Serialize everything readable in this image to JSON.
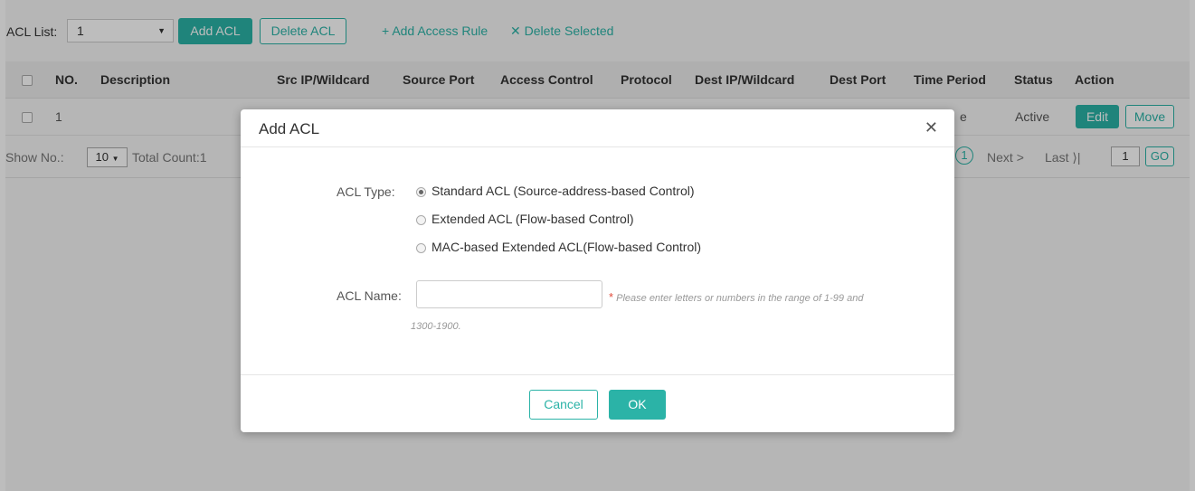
{
  "toolbar": {
    "acl_list_label": "ACL List:",
    "acl_list_value": "1",
    "add_acl_label": "Add ACL",
    "delete_acl_label": "Delete ACL",
    "add_access_rule_label": "Add Access Rule",
    "delete_selected_label": "Delete Selected"
  },
  "table": {
    "columns": [
      "NO.",
      "Description",
      "Src IP/Wildcard",
      "Source Port",
      "Access Control",
      "Protocol",
      "Dest IP/Wildcard",
      "Dest Port",
      "Time Period",
      "Status",
      "Action"
    ],
    "rows": [
      {
        "no": "1",
        "time_period_partial": "e",
        "status": "Active",
        "edit_label": "Edit",
        "move_label": "Move"
      }
    ]
  },
  "pager": {
    "show_no_label": "Show No.:",
    "page_size": "10",
    "total_count": "Total Count:1",
    "current_page": "1",
    "next_label": "Next",
    "last_label": "Last",
    "goto_value": "1",
    "go_label": "GO"
  },
  "modal": {
    "title": "Add ACL",
    "acl_type_label": "ACL Type:",
    "options": [
      {
        "label": "Standard ACL (Source-address-based Control)",
        "checked": true
      },
      {
        "label": "Extended ACL (Flow-based Control)",
        "checked": false
      },
      {
        "label": "MAC-based Extended ACL(Flow-based Control)",
        "checked": false
      }
    ],
    "acl_name_label": "ACL Name:",
    "acl_name_value": "",
    "required_mark": "*",
    "hint_line1": "Please enter letters or numbers in the range of 1-99 and",
    "hint_line2": "1300-1900.",
    "cancel_label": "Cancel",
    "ok_label": "OK"
  },
  "colors": {
    "accent": "#2bb3a7",
    "required": "#e24b3b"
  }
}
